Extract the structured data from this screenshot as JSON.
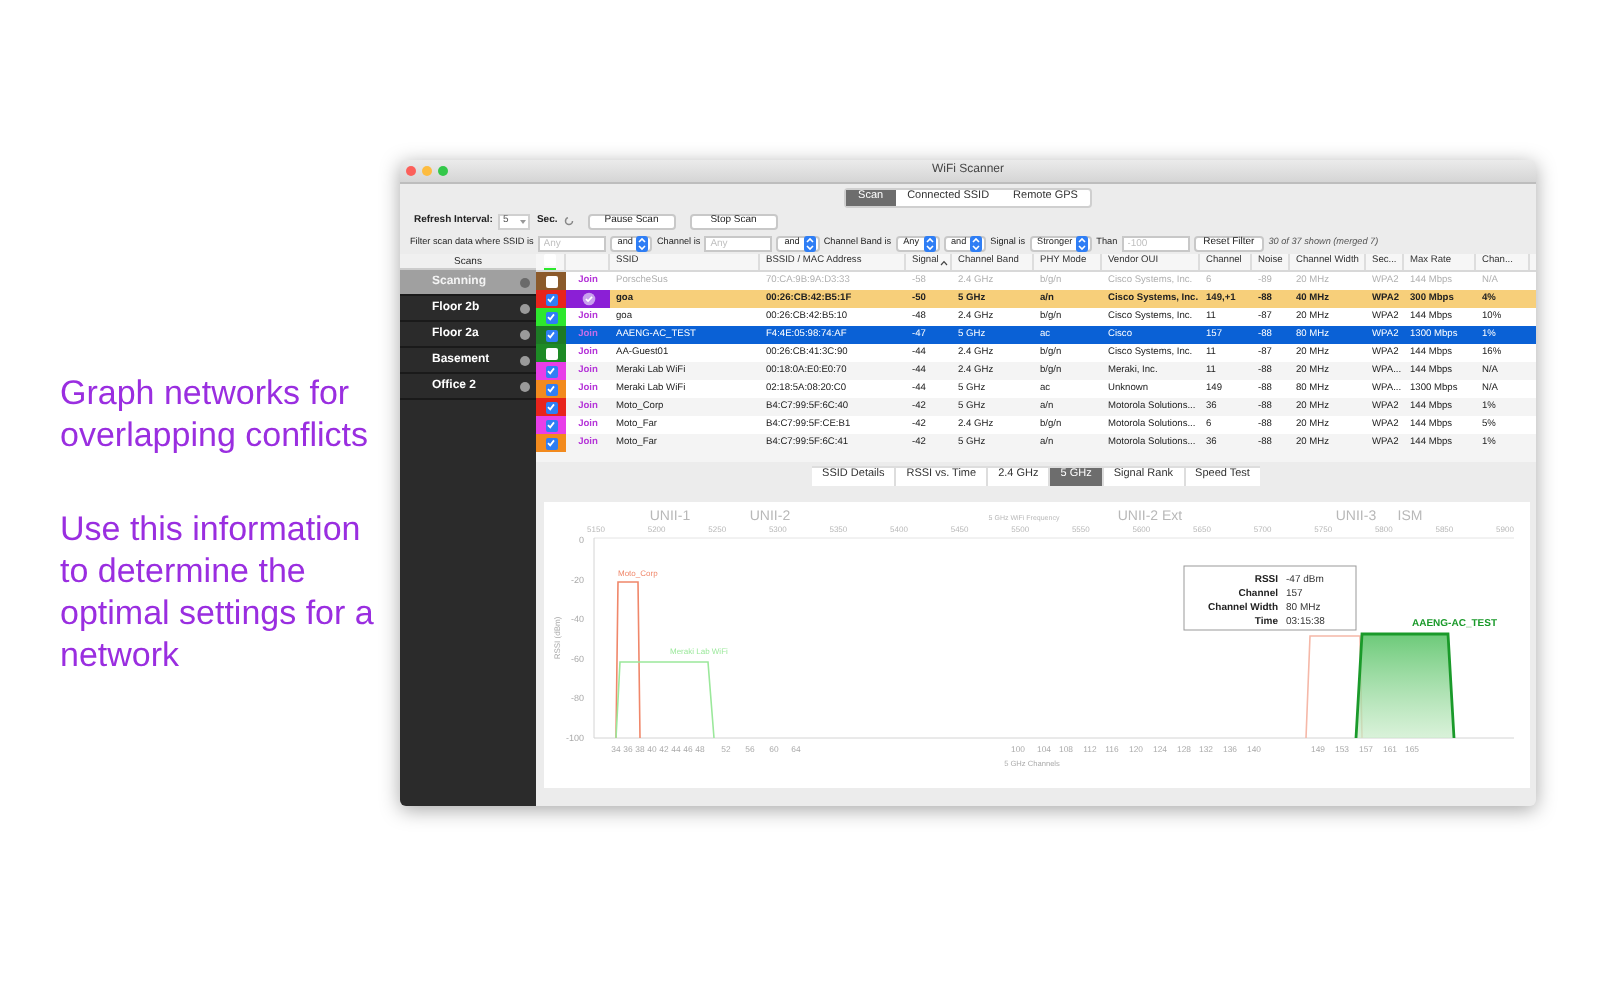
{
  "promo": [
    "Graph networks for overlapping conflicts",
    "Use this information to determine the optimal settings for a network"
  ],
  "window": {
    "title": "WiFi Scanner"
  },
  "modes": [
    {
      "label": "Scan",
      "selected": true
    },
    {
      "label": "Connected SSID",
      "selected": false
    },
    {
      "label": "Remote GPS",
      "selected": false
    }
  ],
  "refresh": {
    "label": "Refresh Interval:",
    "value": "5",
    "unit": "Sec.",
    "buttons": [
      "Pause Scan",
      "Stop Scan"
    ]
  },
  "filter": [
    {
      "kind": "text",
      "text": "Filter scan data where SSID is"
    },
    {
      "kind": "field",
      "placeholder": "Any"
    },
    {
      "kind": "select",
      "value": "and"
    },
    {
      "kind": "text",
      "text": "Channel is"
    },
    {
      "kind": "field",
      "placeholder": "Any"
    },
    {
      "kind": "select",
      "value": "and"
    },
    {
      "kind": "text",
      "text": "Channel Band is"
    },
    {
      "kind": "select",
      "value": "Any"
    },
    {
      "kind": "select",
      "value": "and"
    },
    {
      "kind": "text",
      "text": "Signal is"
    },
    {
      "kind": "select",
      "value": "Stronger"
    },
    {
      "kind": "text",
      "text": "Than"
    },
    {
      "kind": "field",
      "placeholder": "-100"
    },
    {
      "kind": "button",
      "text": "Reset Filter"
    },
    {
      "kind": "note",
      "text": "30 of 37 shown (merged 7)"
    }
  ],
  "sidebar": {
    "title": "Scans",
    "items": [
      {
        "label": "Scanning",
        "selected": true
      },
      {
        "label": "Floor 2b",
        "selected": false
      },
      {
        "label": "Floor 2a",
        "selected": false
      },
      {
        "label": "Basement",
        "selected": false
      },
      {
        "label": "Office 2",
        "selected": false
      }
    ]
  },
  "table": {
    "select_all": {
      "checked": false
    },
    "columns": [
      {
        "label": "SSID",
        "sorted": false
      },
      {
        "label": "BSSID / MAC Address",
        "sorted": false
      },
      {
        "label": "Signal",
        "sorted": true
      },
      {
        "label": "Channel Band",
        "sorted": false
      },
      {
        "label": "PHY Mode",
        "sorted": false
      },
      {
        "label": "Vendor OUI",
        "sorted": false
      },
      {
        "label": "Channel",
        "sorted": false
      },
      {
        "label": "Noise",
        "sorted": false
      },
      {
        "label": "Channel Width",
        "sorted": false
      },
      {
        "label": "Sec...",
        "sorted": false
      },
      {
        "label": "Max Rate",
        "sorted": false
      },
      {
        "label": "Chan...",
        "sorted": false
      }
    ],
    "rows": [
      {
        "color": "#8b5a2b",
        "checked": false,
        "connected": false,
        "selected": false,
        "disabled": true,
        "join": "Join",
        "cells": [
          "PorscheSus",
          "70:CA:9B:9A:D3:33",
          "-58",
          "2.4 GHz",
          "b/g/n",
          "Cisco Systems, Inc.",
          "6",
          "-89",
          "20 MHz",
          "WPA2",
          "144 Mbps",
          "N/A"
        ]
      },
      {
        "color": "#e8241c",
        "checked": true,
        "connected": true,
        "selected": false,
        "disabled": false,
        "cells": [
          "goa",
          "00:26:CB:42:B5:1F",
          "-50",
          "5 GHz",
          "a/n",
          "Cisco Systems, Inc.",
          "149,+1",
          "-88",
          "40 MHz",
          "WPA2",
          "300 Mbps",
          "4%"
        ]
      },
      {
        "color": "#2ee82e",
        "checked": true,
        "connected": false,
        "selected": false,
        "disabled": false,
        "join": "Join",
        "cells": [
          "goa",
          "00:26:CB:42:B5:10",
          "-48",
          "2.4 GHz",
          "b/g/n",
          "Cisco Systems, Inc.",
          "11",
          "-87",
          "20 MHz",
          "WPA2",
          "144 Mbps",
          "10%"
        ]
      },
      {
        "color": "#1d7a25",
        "checked": true,
        "connected": false,
        "selected": true,
        "disabled": false,
        "join": "Join",
        "cells": [
          "AAENG-AC_TEST",
          "F4:4E:05:98:74:AF",
          "-47",
          "5 GHz",
          "ac",
          "Cisco",
          "157",
          "-88",
          "80 MHz",
          "WPA2",
          "1300 Mbps",
          "1%"
        ]
      },
      {
        "color": "#1d8a25",
        "checked": false,
        "connected": false,
        "selected": false,
        "disabled": false,
        "join": "Join",
        "cells": [
          "AA-Guest01",
          "00:26:CB:41:3C:90",
          "-44",
          "2.4 GHz",
          "b/g/n",
          "Cisco Systems, Inc.",
          "11",
          "-87",
          "20 MHz",
          "WPA2",
          "144 Mbps",
          "16%"
        ]
      },
      {
        "color": "#e83ee8",
        "checked": true,
        "connected": false,
        "selected": false,
        "disabled": false,
        "join": "Join",
        "cells": [
          "Meraki Lab WiFi",
          "00:18:0A:E0:E0:70",
          "-44",
          "2.4 GHz",
          "b/g/n",
          "Meraki, Inc.",
          "11",
          "-88",
          "20 MHz",
          "WPA...",
          "144 Mbps",
          "N/A"
        ]
      },
      {
        "color": "#f28a1e",
        "checked": true,
        "connected": false,
        "selected": false,
        "disabled": false,
        "join": "Join",
        "cells": [
          "Meraki Lab WiFi",
          "02:18:5A:08:20:C0",
          "-44",
          "5 GHz",
          "ac",
          "Unknown",
          "149",
          "-88",
          "80 MHz",
          "WPA...",
          "1300 Mbps",
          "N/A"
        ]
      },
      {
        "color": "#e8241c",
        "checked": true,
        "connected": false,
        "selected": false,
        "disabled": false,
        "join": "Join",
        "cells": [
          "Moto_Corp",
          "B4:C7:99:5F:6C:40",
          "-42",
          "5 GHz",
          "a/n",
          "Motorola Solutions...",
          "36",
          "-88",
          "20 MHz",
          "WPA2",
          "144 Mbps",
          "1%"
        ]
      },
      {
        "color": "#e83ee8",
        "checked": true,
        "connected": false,
        "selected": false,
        "disabled": false,
        "join": "Join",
        "cells": [
          "Moto_Far",
          "B4:C7:99:5F:CE:B1",
          "-42",
          "2.4 GHz",
          "b/g/n",
          "Motorola Solutions...",
          "6",
          "-88",
          "20 MHz",
          "WPA2",
          "144 Mbps",
          "5%"
        ]
      },
      {
        "color": "#f28a1e",
        "checked": true,
        "connected": false,
        "selected": false,
        "disabled": false,
        "join": "Join",
        "cells": [
          "Moto_Far",
          "B4:C7:99:5F:6C:41",
          "-42",
          "5 GHz",
          "a/n",
          "Motorola Solutions...",
          "36",
          "-88",
          "20 MHz",
          "WPA2",
          "144 Mbps",
          "1%"
        ]
      }
    ]
  },
  "views": [
    {
      "label": "SSID Details",
      "selected": false
    },
    {
      "label": "RSSI vs. Time",
      "selected": false
    },
    {
      "label": "2.4 GHz",
      "selected": false
    },
    {
      "label": "5 GHz",
      "selected": true
    },
    {
      "label": "Signal Rank",
      "selected": false
    },
    {
      "label": "Speed Test",
      "selected": false
    }
  ],
  "spectrum": {
    "bands": [
      "UNII-1",
      "UNII-2",
      "5 GHz WiFi Frequency",
      "UNII-2 Ext",
      "UNII-3",
      "ISM"
    ],
    "frequencies": [
      "5150",
      "5200",
      "5250",
      "5300",
      "5350",
      "5400",
      "5450",
      "5500",
      "5550",
      "5600",
      "5650",
      "5700",
      "5750",
      "5800",
      "5850",
      "5900"
    ],
    "ylabel": "RSSI (dBm)",
    "yticks": [
      "0",
      "-20",
      "-40",
      "-60",
      "-80",
      "-100"
    ],
    "xlabel": "5 GHz Channels",
    "channels": [
      "34",
      "36",
      "38",
      "40",
      "42",
      "44",
      "46",
      "48",
      "52",
      "56",
      "60",
      "64",
      "100",
      "104",
      "108",
      "112",
      "116",
      "120",
      "124",
      "128",
      "132",
      "136",
      "140",
      "149",
      "153",
      "157",
      "161",
      "165"
    ],
    "networks": [
      {
        "label": "Moto_Corp",
        "color": "#f0876a"
      },
      {
        "label": "Meraki Lab WiFi",
        "color": "#9be89b"
      },
      {
        "label": "AAENG-AC_TEST",
        "color": "#1a9a2a"
      }
    ],
    "tooltip": [
      {
        "key": "RSSI",
        "value": "-47 dBm"
      },
      {
        "key": "Channel",
        "value": "157"
      },
      {
        "key": "Channel Width",
        "value": "80 MHz"
      },
      {
        "key": "Time",
        "value": "03:15:38"
      }
    ]
  }
}
